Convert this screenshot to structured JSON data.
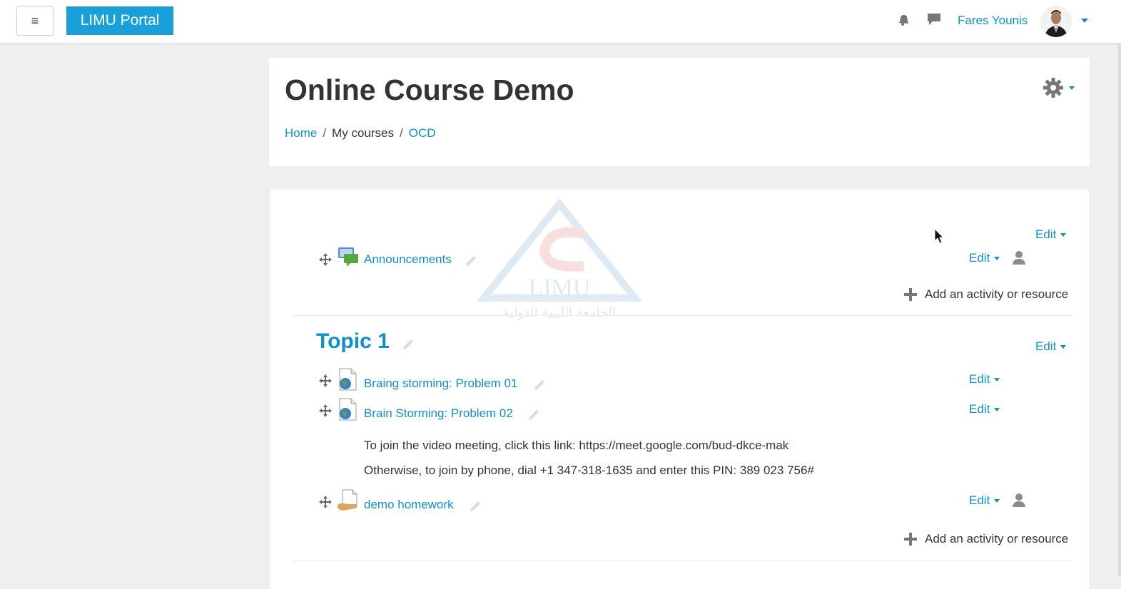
{
  "navbar": {
    "menu_glyph": "≡",
    "brand_label": "LIMU Portal",
    "notification_icon": "bell-icon",
    "messages_icon": "speech-bubble-icon",
    "user_name": "Fares Younis"
  },
  "header": {
    "title": "Online Course Demo",
    "settings_icon": "gear-icon",
    "breadcrumb": [
      {
        "label": "Home",
        "link": true
      },
      {
        "label": "My courses",
        "link": false
      },
      {
        "label": "OCD",
        "link": true
      }
    ],
    "breadcrumb_separator": "/"
  },
  "watermark": {
    "latin": "LIMU",
    "arabic": "الجامعة الليبية الدولية"
  },
  "sections": {
    "general": {
      "edit_label": "Edit",
      "activities": [
        {
          "name": "Announcements",
          "icon": "forum-icon",
          "edit_label": "Edit",
          "role_icon": "user-icon"
        }
      ],
      "add_label": "Add an activity or resource"
    },
    "topic1": {
      "title": "Topic 1",
      "edit_label": "Edit",
      "activities": [
        {
          "name": "Braing storming: Problem 01",
          "icon": "url-resource-icon",
          "edit_label": "Edit"
        },
        {
          "name": "Brain Storming: Problem 02",
          "icon": "url-resource-icon",
          "edit_label": "Edit"
        },
        {
          "name": "demo homework",
          "icon": "assignment-icon",
          "edit_label": "Edit",
          "role_icon": "user-icon"
        }
      ],
      "description_lines": [
        "To join the video meeting, click this link: https://meet.google.com/bud-dkce-mak",
        "Otherwise, to join by phone, dial +1 347-318-1635 and enter this PIN: 389 023 756#"
      ],
      "add_label": "Add an activity or resource"
    }
  },
  "colors": {
    "link": "#0f8fcc",
    "brand": "#1aa0d8",
    "background": "#efefef"
  }
}
